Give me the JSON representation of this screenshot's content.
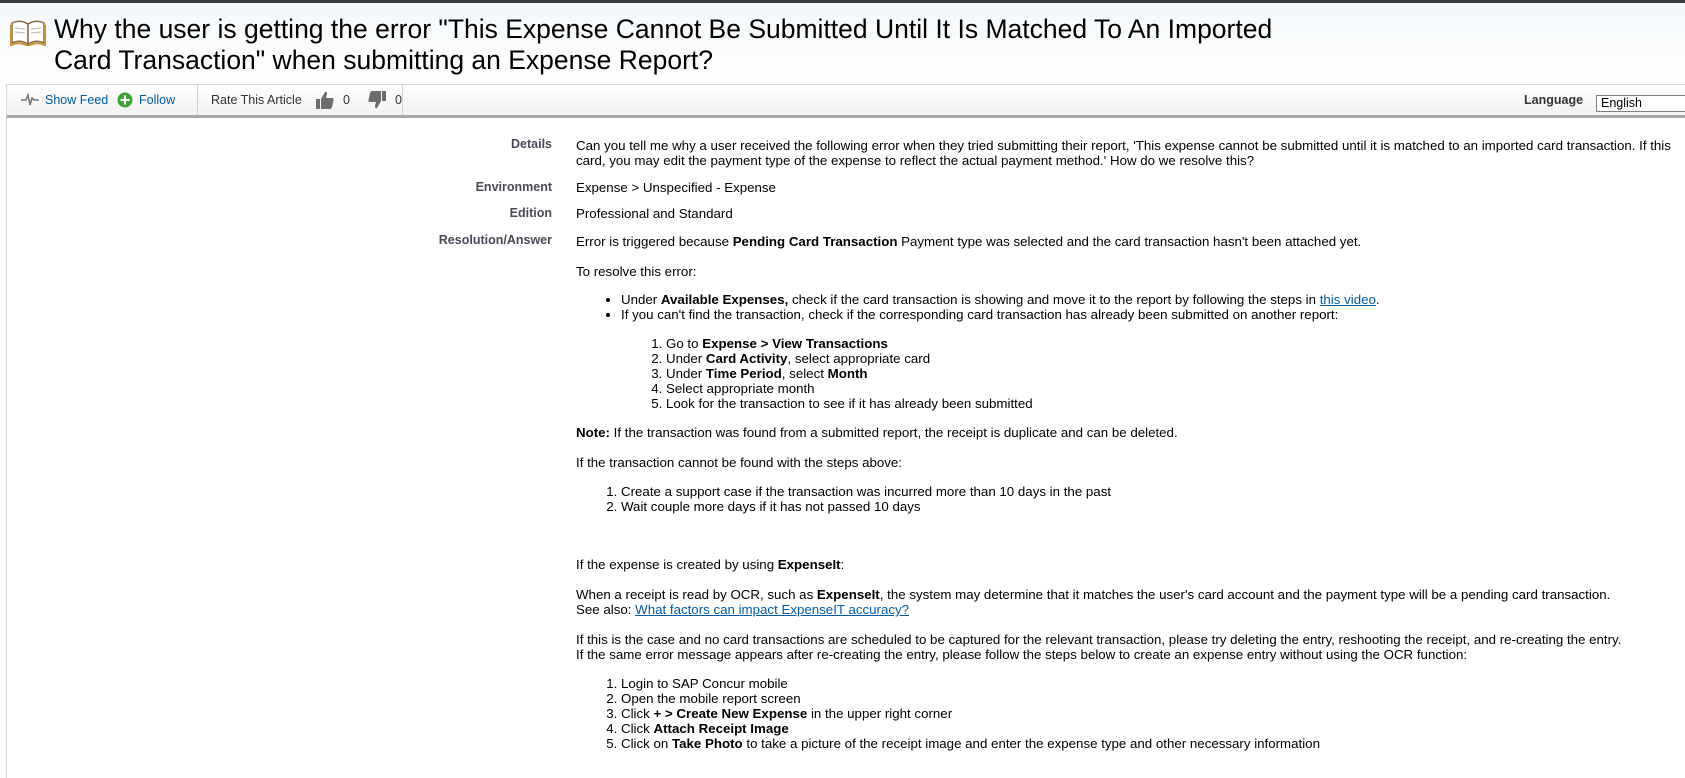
{
  "title": {
    "line1": "Why the user is getting the error \"This Expense Cannot Be Submitted Until It Is Matched To An Imported",
    "line2": "Card Transaction\" when submitting an Expense Report?"
  },
  "toolbar": {
    "show_feed": "Show Feed",
    "follow": "Follow",
    "rate_label": "Rate This Article",
    "thumbs_up_count": "0",
    "thumbs_down_count": "0",
    "language_label": "Language",
    "language_value": "English"
  },
  "fields": {
    "details_label": "Details",
    "details_line1": "Can you tell me why a user received the following error when they tried submitting their report, 'This expense cannot be submitted until it is matched to an imported card transaction. If this",
    "details_line2": "card, you may edit the payment type of the expense to reflect the actual payment method.' How do we resolve this?",
    "environment_label": "Environment",
    "environment_value": "Expense > Unspecified - Expense",
    "edition_label": "Edition",
    "edition_value": "Professional and Standard",
    "resolution_label": "Resolution/Answer"
  },
  "resolution": {
    "intro_pre": "Error is triggered because ",
    "intro_bold": "Pending Card Transaction",
    "intro_post": " Payment type was selected and the card transaction hasn't been attached yet.",
    "to_resolve": "To resolve this error:",
    "b1_pre": "Under ",
    "b1_bold": "Available Expenses,",
    "b1_post": " check if the card transaction is showing and move it to the report by following the steps in ",
    "b1_link": "this video",
    "b1_end": ".",
    "b2": "If you can't find the transaction, check if the corresponding card transaction has already been submitted on another report:",
    "s1_pre": "Go to ",
    "s1_bold": "Expense > View Transactions",
    "s2_pre": "Under ",
    "s2_bold": "Card Activity",
    "s2_post": ", select appropriate card",
    "s3_pre": "Under ",
    "s3_bold1": "Time Period",
    "s3_mid": ", select ",
    "s3_bold2": "Month",
    "s4": "Select appropriate month",
    "s5": "Look for the transaction to see if it has already been submitted",
    "note_bold": "Note:",
    "note_text": " If the transaction was found from a submitted report, the receipt is duplicate and can be deleted.",
    "cannot_find": "If the transaction cannot be found with the steps above:",
    "c1": "Create a support case if the transaction was incurred more than 10 days in the past",
    "c2": "Wait couple more days if it has not passed 10 days",
    "expenseit_pre": "If the expense is created by using ",
    "expenseit_bold": "ExpenseIt",
    "expenseit_post": ":",
    "ocr_pre": "When a receipt is read by OCR, such as ",
    "ocr_bold": "ExpenseIt",
    "ocr_post": ", the system may determine that it matches the user's card account and the payment type will be a pending card transaction.",
    "see_also": "See also: ",
    "see_also_link": "What factors can impact ExpenseIT accuracy?",
    "case_line1": "If this is the case and no card transactions are scheduled to be captured for the relevant transaction, please try deleting the entry, reshooting the receipt, and re-creating the entry.",
    "case_line2": "If the same error message appears after re-creating the entry, please follow the steps below to create an expense entry without using the OCR function:",
    "m1": "Login to SAP Concur mobile",
    "m2": "Open the mobile report screen",
    "m3_pre": "Click ",
    "m3_bold": "+ > Create New Expense",
    "m3_post": " in the upper right corner",
    "m4_pre": "Click ",
    "m4_bold": "Attach Receipt Image",
    "m5_pre": "Click on ",
    "m5_bold": "Take Photo",
    "m5_post": " to take a picture of the receipt image and enter the expense type and other necessary information"
  }
}
